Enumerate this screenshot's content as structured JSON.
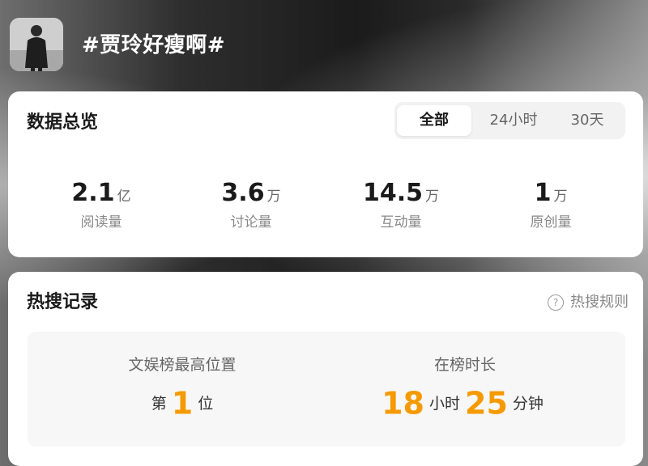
{
  "topic": {
    "title": "#贾玲好瘦啊#"
  },
  "overview": {
    "title": "数据总览",
    "tabs": [
      {
        "label": "全部",
        "active": true
      },
      {
        "label": "24小时",
        "active": false
      },
      {
        "label": "30天",
        "active": false
      }
    ],
    "stats": [
      {
        "value": "2.1",
        "unit": "亿",
        "label": "阅读量"
      },
      {
        "value": "3.6",
        "unit": "万",
        "label": "讨论量"
      },
      {
        "value": "14.5",
        "unit": "万",
        "label": "互动量"
      },
      {
        "value": "1",
        "unit": "万",
        "label": "原创量"
      }
    ]
  },
  "hot_search": {
    "title": "热搜记录",
    "rules_link": "热搜规则",
    "rules_icon": "question-circle-icon",
    "highest_rank": {
      "label": "文娱榜最高位置",
      "prefix": "第",
      "value": "1",
      "suffix": "位"
    },
    "duration": {
      "label": "在榜时长",
      "hours": "18",
      "hours_unit": "小时",
      "minutes": "25",
      "minutes_unit": "分钟"
    }
  },
  "colors": {
    "accent_orange": "#f59a00",
    "card_bg": "#ffffff",
    "panel_bg": "#f7f7f7"
  }
}
